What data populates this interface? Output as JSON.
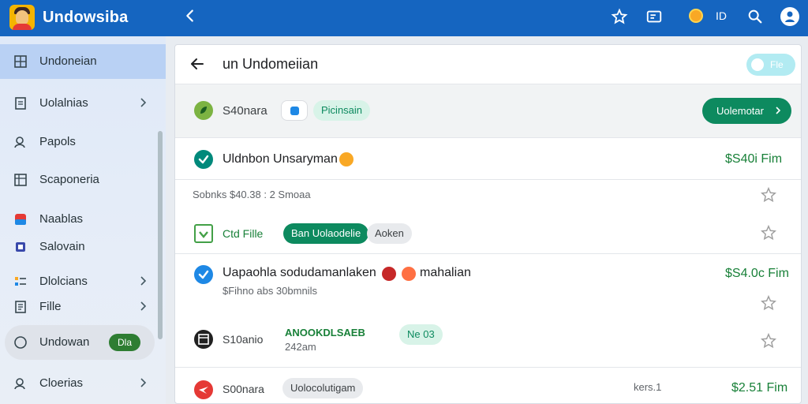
{
  "app": {
    "title": "Undowsiba"
  },
  "topbar": {
    "status_text": "ID"
  },
  "sidebar": {
    "items": [
      {
        "label": "Undoneian",
        "icon": "grid-icon"
      },
      {
        "label": "Uolalnias",
        "icon": "document-icon"
      },
      {
        "label": "Papols",
        "icon": "person-icon"
      },
      {
        "label": "Scaponeria",
        "icon": "table-icon"
      },
      {
        "label": "Naablas",
        "icon": "tile-icon"
      },
      {
        "label": "Salovain",
        "icon": "square-icon"
      },
      {
        "label": "Dlolcians",
        "icon": "bars-icon"
      },
      {
        "label": "Fille",
        "icon": "file-icon"
      },
      {
        "label": "Undowan",
        "icon": "circle-icon",
        "badge": "Dla"
      },
      {
        "label": "Cloerias",
        "icon": "person-icon"
      }
    ]
  },
  "main": {
    "title": "un Undomeiian",
    "toggle_label": "Fle",
    "filter": {
      "label": "S40nara",
      "chip": "Picinsain",
      "cta": "Uolemotar"
    },
    "rows": [
      {
        "title": "Uldnbon Unsaryman",
        "price": "$S40i Fim",
        "sub": "Sobnks $40.38 : 2 Smoaa"
      },
      {
        "label": "Ctd Fille",
        "chip_primary": "Ban Uolaodelie",
        "chip_secondary": "Aoken"
      },
      {
        "title": "Uapaohla sodudamanlaken",
        "title_suffix": "mahalian",
        "price": "$S4.0c Fim",
        "sub": "$Fihno abs 30bmnils"
      },
      {
        "label": "S10anio",
        "green_text": "ANOOKDLSAEB",
        "sub": "242am",
        "chip": "Ne 03"
      },
      {
        "label": "S00nara",
        "chip": "Uolocolutigam",
        "meta": "kers.1",
        "price": "$2.51 Fim"
      }
    ]
  },
  "colors": {
    "topbar": "#1565c0",
    "accent_green": "#0d8a5f",
    "price_green": "#188038",
    "active_sidebar": "#b9d1f4"
  }
}
